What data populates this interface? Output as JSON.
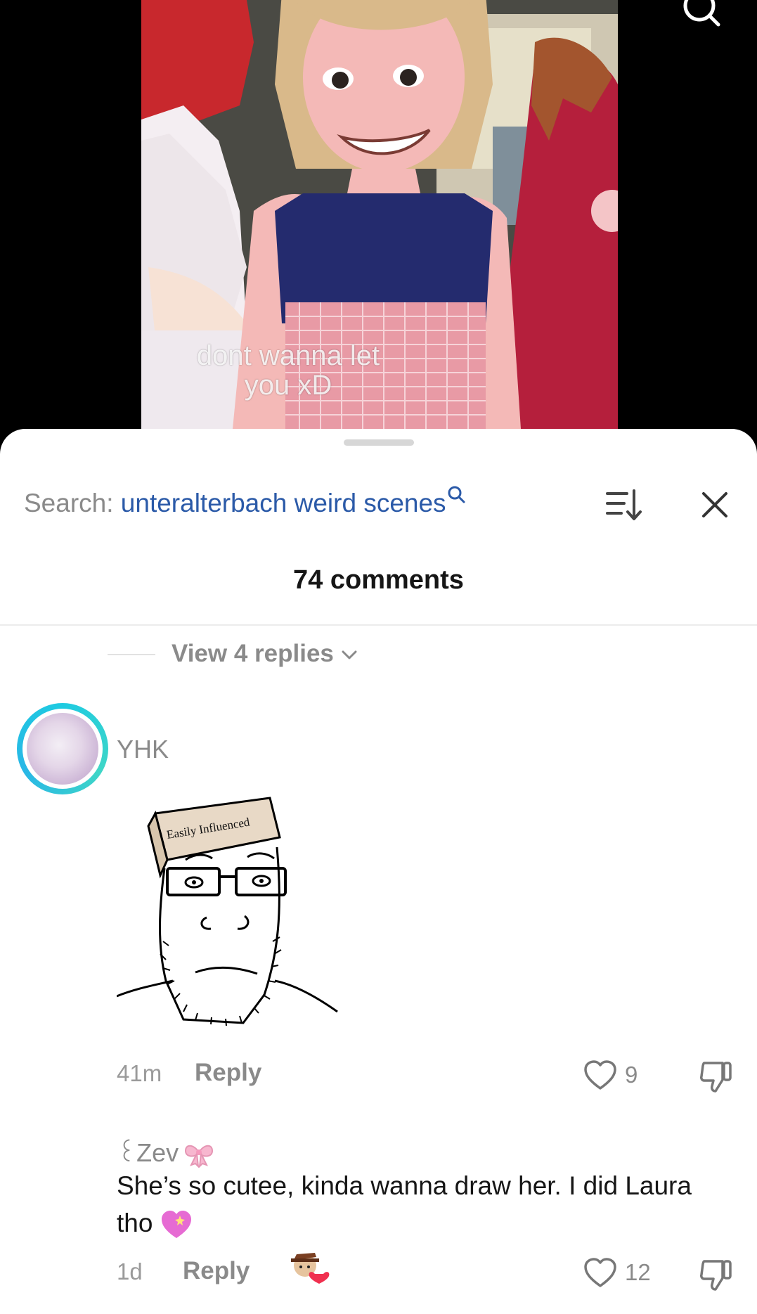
{
  "video": {
    "caption": "dont wanna let you xD"
  },
  "panel": {
    "search_prefix": "Search:",
    "search_term": "unteralterbach weird scenes",
    "comments_count": "74 comments",
    "view_replies": "View 4 replies"
  },
  "comments": [
    {
      "username": "YHK",
      "image_text": "Easily Influenced",
      "time": "41m",
      "reply_label": "Reply",
      "likes": "9"
    },
    {
      "username": "꒰Zev",
      "text": "She’s so cutee, kinda wanna draw her. I did Laura tho",
      "time": "1d",
      "reply_label": "Reply",
      "likes": "12"
    }
  ],
  "icons": {
    "search": "search-icon",
    "sort": "sort-icon",
    "close": "close-icon",
    "like": "heart-outline-icon",
    "dislike": "thumbs-down-icon",
    "bow": "pink-bow-icon",
    "sparkling_heart": "sparkling-heart-icon"
  },
  "colors": {
    "search_term": "#2b5aa8",
    "avatar_ring": "#1ecbe1",
    "muted_text": "#8a8a8a"
  }
}
